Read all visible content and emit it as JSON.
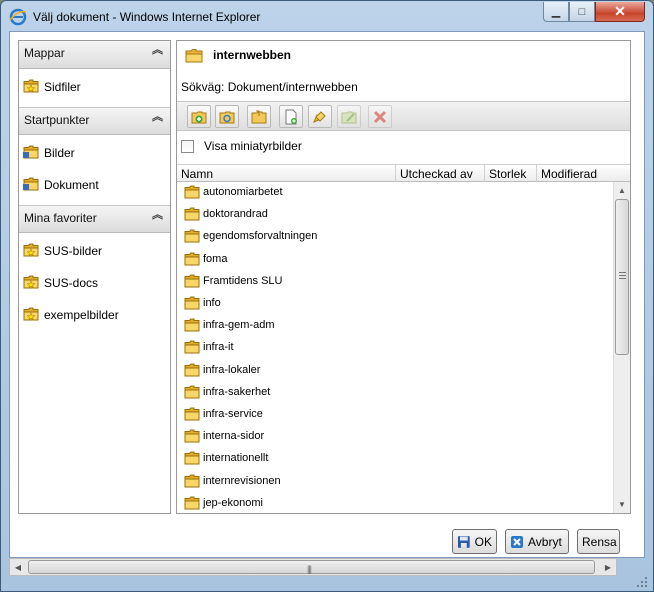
{
  "window": {
    "title": "Välj dokument - Windows Internet Explorer"
  },
  "sidebar": {
    "sections": [
      {
        "title": "Mappar",
        "items": [
          {
            "label": "Sidfiler"
          }
        ]
      },
      {
        "title": "Startpunkter",
        "items": [
          {
            "label": "Bilder"
          },
          {
            "label": "Dokument"
          }
        ]
      },
      {
        "title": "Mina favoriter",
        "items": [
          {
            "label": "SUS-bilder"
          },
          {
            "label": "SUS-docs"
          },
          {
            "label": "exempelbilder"
          }
        ]
      }
    ]
  },
  "main": {
    "folder_title": "internwebben",
    "path": "Sökväg: Dokument/internwebben",
    "thumbnails_label": "Visa miniatyrbilder",
    "columns": [
      "Namn",
      "Utcheckad av",
      "Storlek",
      "Modifierad"
    ],
    "rows": [
      "autonomiarbetet",
      "doktorandrad",
      "egendomsforvaltningen",
      "foma",
      "Framtidens SLU",
      "info",
      "infra-gem-adm",
      "infra-it",
      "infra-lokaler",
      "infra-sakerhet",
      "infra-service",
      "interna-sidor",
      "internationellt",
      "internrevisionen",
      "jep-ekonomi"
    ]
  },
  "buttons": {
    "ok": "OK",
    "cancel": "Avbryt",
    "clear": "Rensa"
  },
  "icons": {
    "toolbar": [
      "add-folder-icon",
      "refresh-folder-icon",
      "open-folder-icon",
      "new-file-icon",
      "rename-icon",
      "edit-icon",
      "delete-icon"
    ]
  }
}
